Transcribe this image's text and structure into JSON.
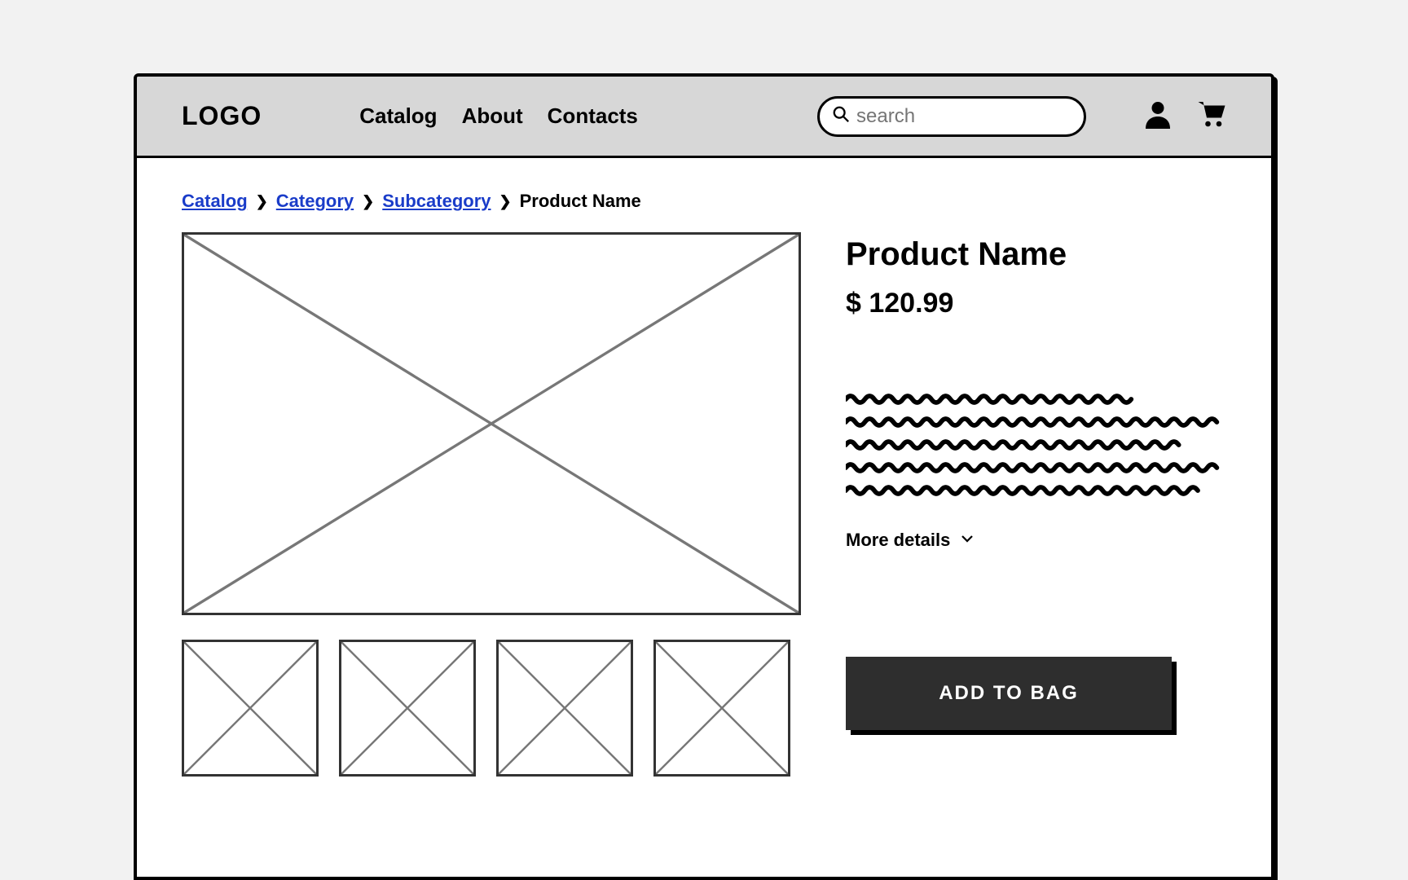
{
  "header": {
    "logo": "LOGO",
    "nav": {
      "catalog": "Catalog",
      "about": "About",
      "contacts": "Contacts"
    },
    "search_placeholder": "search"
  },
  "breadcrumbs": {
    "catalog": "Catalog",
    "category": "Category",
    "subcategory": "Subcategory",
    "current": "Product Name"
  },
  "product": {
    "title": "Product Name",
    "price": "$ 120.99",
    "more_details_label": "More details",
    "add_to_bag_label": "ADD TO BAG"
  }
}
